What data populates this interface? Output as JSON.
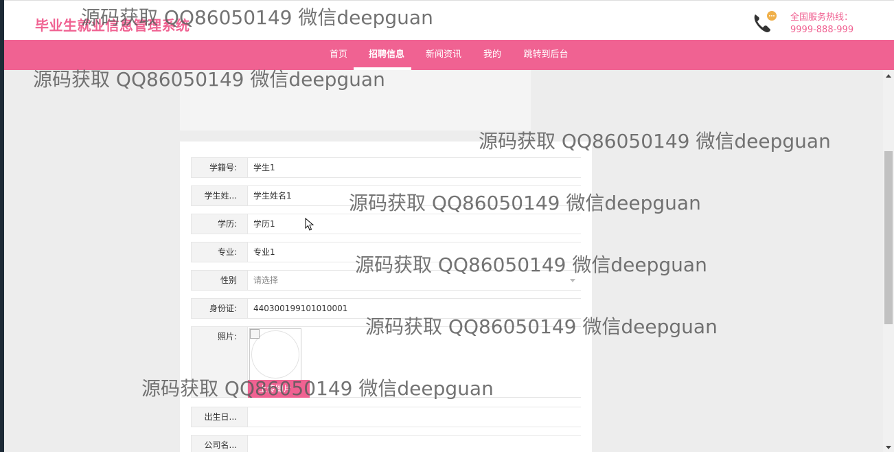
{
  "header": {
    "logo": "毕业生就业信息管理系统",
    "hotline_label": "全国服务热线：",
    "hotline_number": "9999-888-999",
    "phone_icon": "phone-icon"
  },
  "nav": {
    "items": [
      "首页",
      "招聘信息",
      "新闻资讯",
      "我的",
      "跳转到后台"
    ],
    "active_index": 1
  },
  "form": {
    "fields": [
      {
        "label": "学籍号:",
        "value": "学生1"
      },
      {
        "label": "学生姓...",
        "value": "学生姓名1"
      },
      {
        "label": "学历:",
        "value": "学历1"
      },
      {
        "label": "专业:",
        "value": "专业1"
      },
      {
        "label": "性别",
        "value": "",
        "placeholder": "请选择"
      },
      {
        "label": "身份证:",
        "value": "440300199101010001"
      },
      {
        "label": "照片:",
        "upload_label": "上传图片"
      },
      {
        "label": "出生日...",
        "value": ""
      },
      {
        "label": "公司名...",
        "value": ""
      }
    ]
  },
  "watermark": "源码获取 QQ86050149 微信deepguan",
  "colors": {
    "accent": "#f06292",
    "background": "#ededed",
    "sidebar_strip": "#1d2a36"
  }
}
